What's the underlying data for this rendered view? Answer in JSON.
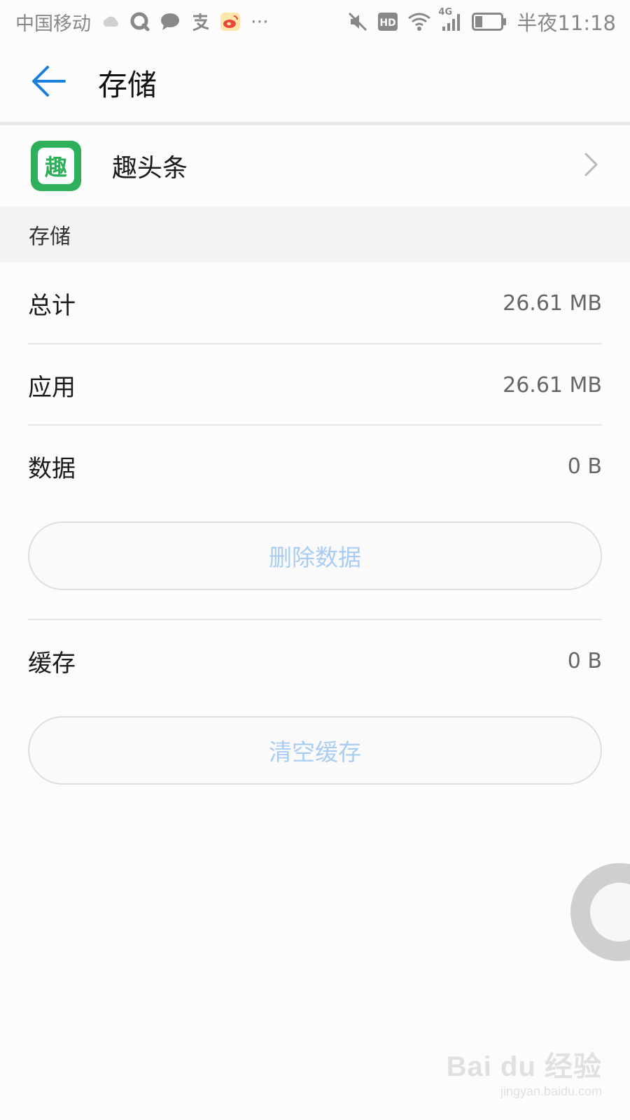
{
  "status_bar": {
    "carrier": "中国移动",
    "network": "4G",
    "time": "半夜11:18",
    "more_dots": "···"
  },
  "header": {
    "title": "存储"
  },
  "app": {
    "name": "趣头条",
    "icon_glyph": "趣",
    "icon_color": "#2eb05b"
  },
  "storage": {
    "section_title": "存储",
    "rows": [
      {
        "label": "总计",
        "value": "26.61 MB"
      },
      {
        "label": "应用",
        "value": "26.61 MB"
      },
      {
        "label": "数据",
        "value": "0 B"
      }
    ],
    "clear_data_label": "删除数据",
    "cache": {
      "label": "缓存",
      "value": "0 B"
    },
    "clear_cache_label": "清空缓存"
  },
  "watermark": {
    "logo": "Bai du 经验",
    "url": "jingyan.baidu.com"
  },
  "colors": {
    "accent": "#1a7fd9",
    "disabled_button_text": "#a9cdf2"
  }
}
